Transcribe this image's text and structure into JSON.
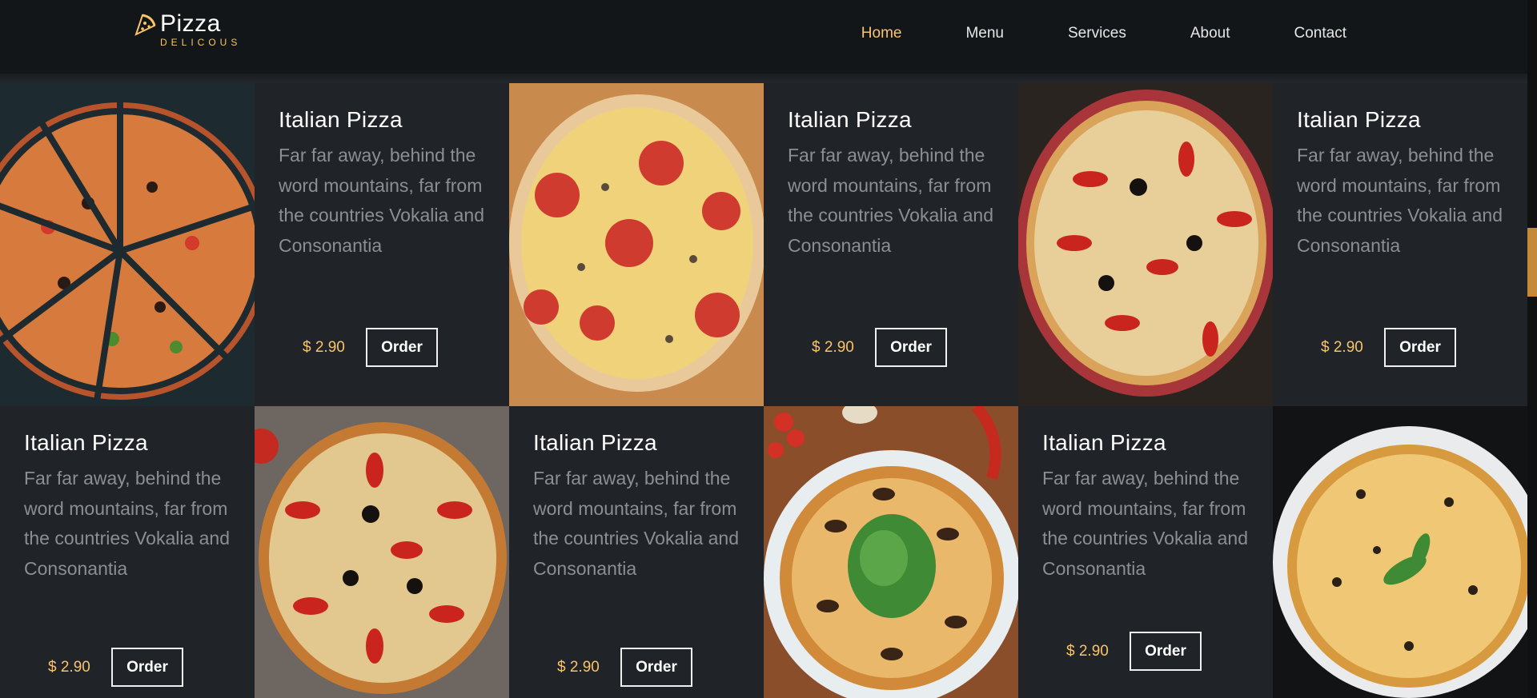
{
  "brand": {
    "name": "Pizza",
    "sub": "DELICOUS"
  },
  "nav": [
    {
      "label": "Home",
      "active": true
    },
    {
      "label": "Menu",
      "active": false
    },
    {
      "label": "Services",
      "active": false
    },
    {
      "label": "About",
      "active": false
    },
    {
      "label": "Contact",
      "active": false
    }
  ],
  "products": [
    {
      "title": "Italian Pizza",
      "desc": "Far far away, behind the word mountains, far from the countries Vokalia and Consonantia",
      "price": "$ 2.90",
      "order": "Order"
    },
    {
      "title": "Italian Pizza",
      "desc": "Far far away, behind the word mountains, far from the countries Vokalia and Consonantia",
      "price": "$ 2.90",
      "order": "Order"
    },
    {
      "title": "Italian Pizza",
      "desc": "Far far away, behind the word mountains, far from the countries Vokalia and Consonantia",
      "price": "$ 2.90",
      "order": "Order"
    },
    {
      "title": "Italian Pizza",
      "desc": "Far far away, behind the word mountains, far from the countries Vokalia and Consonantia",
      "price": "$ 2.90",
      "order": "Order"
    },
    {
      "title": "Italian Pizza",
      "desc": "Far far away, behind the word mountains, far from the countries Vokalia and Consonantia",
      "price": "$ 2.90",
      "order": "Order"
    },
    {
      "title": "Italian Pizza",
      "desc": "Far far away, behind the word mountains, far from the countries Vokalia and Consonantia",
      "price": "$ 2.90",
      "order": "Order"
    }
  ],
  "colors": {
    "accent": "#fac564",
    "panel": "#202327",
    "nav_bg": "#121619"
  }
}
